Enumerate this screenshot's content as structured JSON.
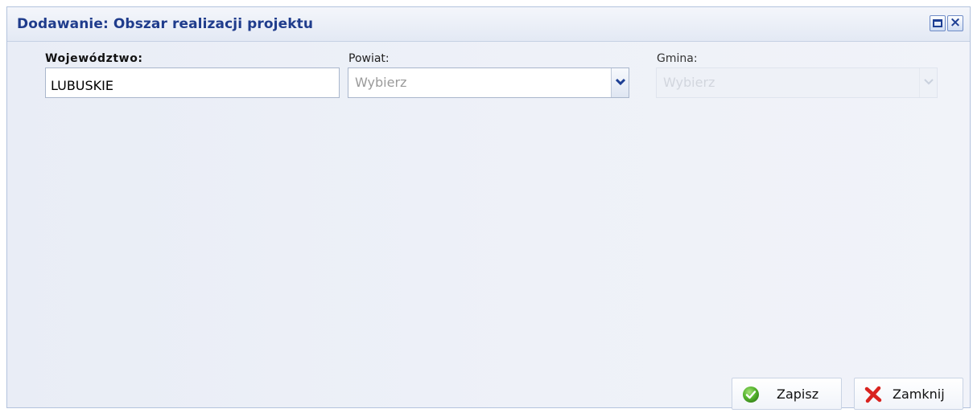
{
  "dialog": {
    "title": "Dodawanie: Obszar realizacji projektu",
    "buttons": {
      "maximize_icon": "maximize-icon",
      "close_icon": "close-icon",
      "close_glyph": "×"
    }
  },
  "form": {
    "wojewodztwo": {
      "label": "Województwo:",
      "value": "LUBUSKIE"
    },
    "powiat": {
      "label": "Powiat:",
      "selected": "Wybierz",
      "enabled": true
    },
    "gmina": {
      "label": "Gmina:",
      "selected": "Wybierz",
      "enabled": false
    }
  },
  "actions": {
    "save": {
      "label": "Zapisz",
      "icon": "check-icon"
    },
    "close": {
      "label": "Zamknij",
      "icon": "red-x-icon"
    }
  },
  "colors": {
    "title": "#1f3c8c",
    "accent": "#1d3f94",
    "save_icon": "#4caf2f",
    "close_icon": "#d9231f"
  }
}
